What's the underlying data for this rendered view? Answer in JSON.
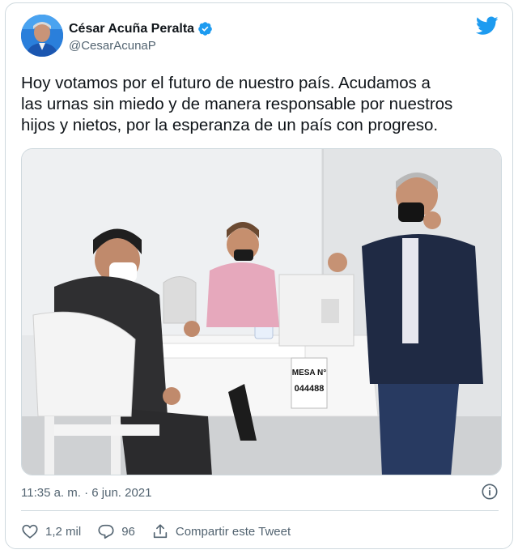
{
  "tweet": {
    "author": {
      "display_name": "César Acuña Peralta",
      "handle": "@CesarAcunaP",
      "verified": true
    },
    "text": "Hoy votamos por el futuro de nuestro país. Acudamos a\nlas urnas sin miedo y de manera responsable por nuestros\nhijos y nietos, por la esperanza de un país con progreso.",
    "media": {
      "sign_mesa": "MESA N°",
      "sign_number": "044488"
    },
    "timestamp": "11:35 a. m. · 6 jun. 2021"
  },
  "actions": {
    "likes": "1,2 mil",
    "replies": "96",
    "share": "Compartir este Tweet"
  },
  "colors": {
    "brand": "#1d9bf0",
    "muted": "#536471",
    "border": "#cfd9de"
  },
  "icons": [
    "twitter-bird-icon",
    "verified-badge-icon",
    "info-icon",
    "heart-icon",
    "reply-icon",
    "share-icon"
  ]
}
